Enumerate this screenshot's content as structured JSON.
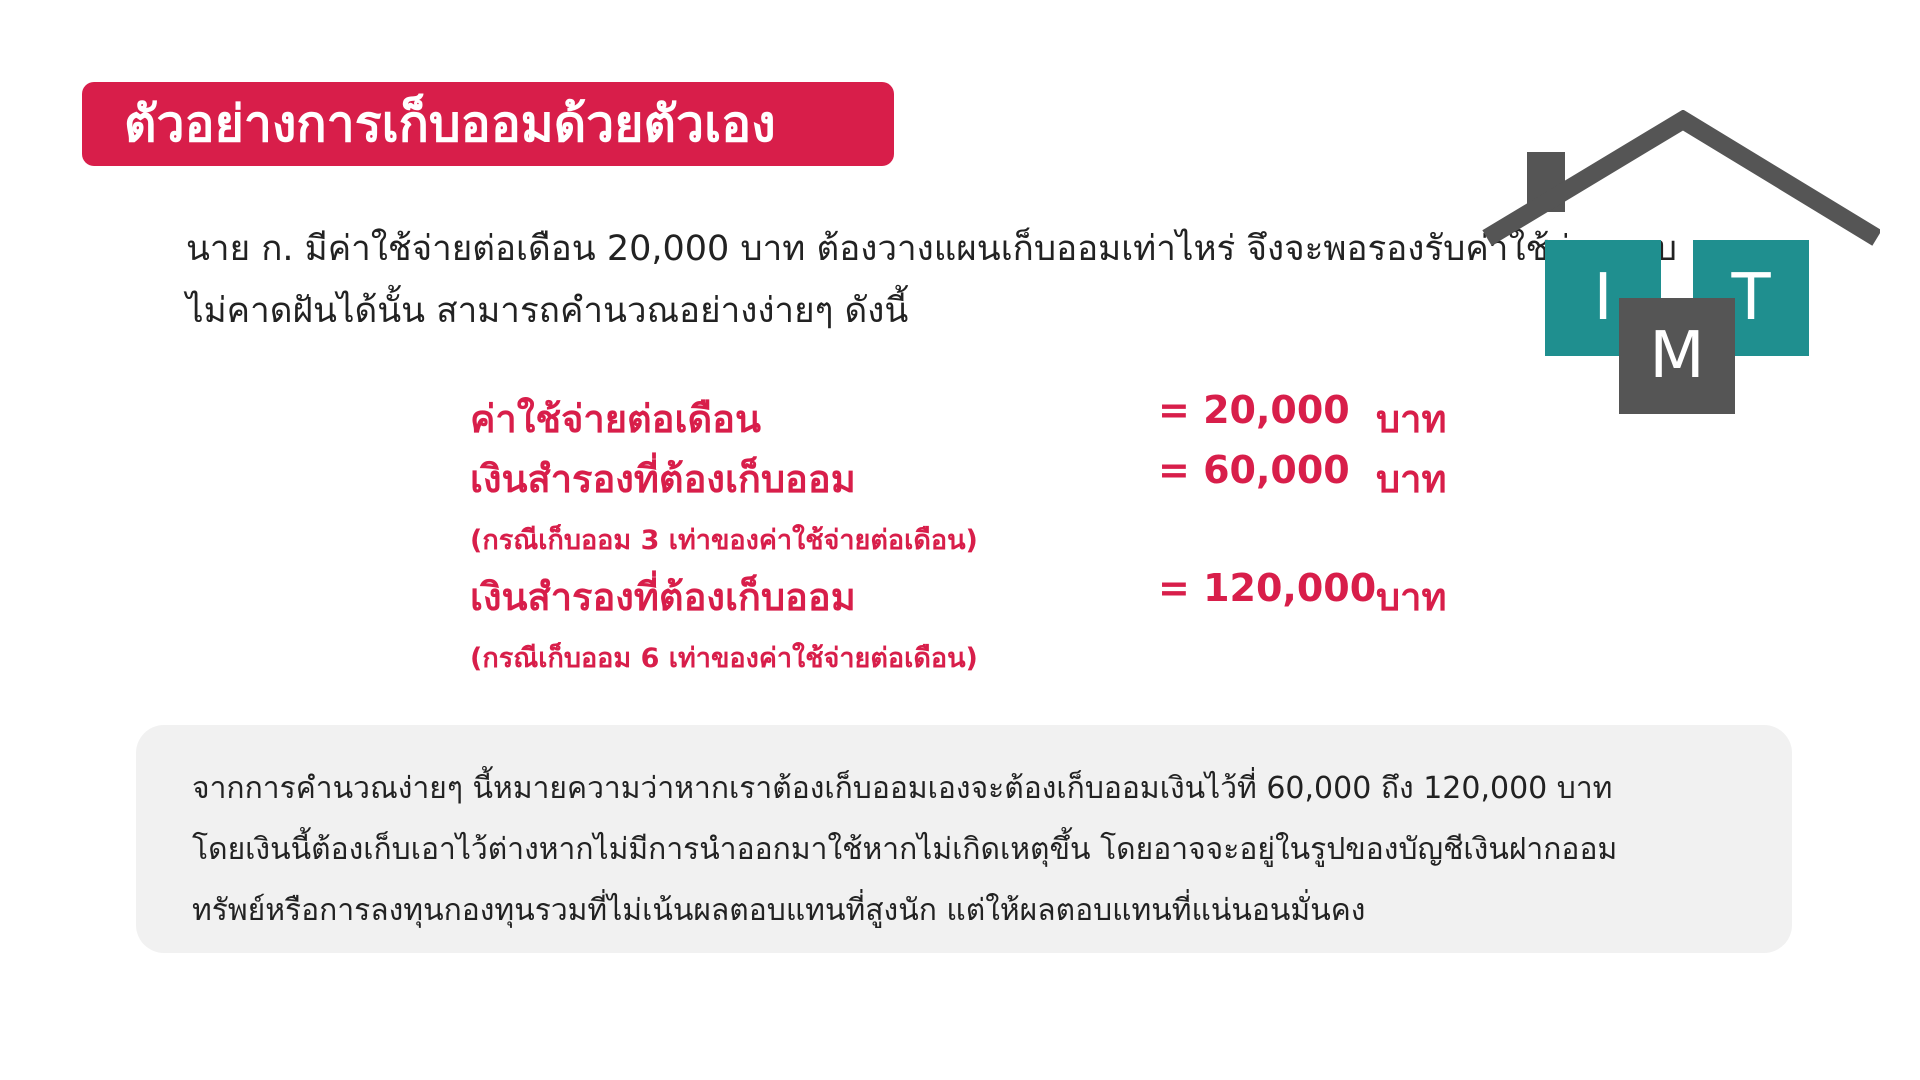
{
  "title": "ตัวอย่างการเก็บออมด้วยตัวเอง",
  "intro": {
    "line1": "นาย ก. มีค่าใช้จ่ายต่อเดือน 20,000 บาท ต้องวางแผนเก็บออมเท่าไหร่ จึงจะพอรองรับค่าใช้จ่ายแบบ",
    "line2": "ไม่คาดฝันได้นั้น สามารถคำนวณอย่างง่ายๆ ดังนี้"
  },
  "calculation": {
    "rows": [
      {
        "label": "ค่าใช้จ่ายต่อเดือน",
        "value": "= 20,000",
        "unit": "บาท"
      },
      {
        "label": "เงินสำรองที่ต้องเก็บออม",
        "value": "= 60,000",
        "unit": "บาท",
        "note": "(กรณีเก็บออม 3 เท่าของค่าใช้จ่ายต่อเดือน)"
      },
      {
        "label": "เงินสำรองที่ต้องเก็บออม",
        "value": "= 120,000",
        "unit": "บาท",
        "note": "(กรณีเก็บออม 6 เท่าของค่าใช้จ่ายต่อเดือน)"
      }
    ]
  },
  "summary": {
    "line1": "จากการคำนวณง่ายๆ นี้หมายความว่าหากเราต้องเก็บออมเองจะต้องเก็บออมเงินไว้ที่ 60,000 ถึง 120,000 บาท",
    "line2": "โดยเงินนี้ต้องเก็บเอาไว้ต่างหากไม่มีการนำออกมาใช้หากไม่เกิดเหตุขึ้น โดยอาจจะอยู่ในรูปของบัญชีเงินฝากออม",
    "line3": "ทรัพย์หรือการลงทุนกองทุนรวมที่ไม่เน้นผลตอบแทนที่สูงนัก แต่ให้ผลตอบแทนที่แน่นอนมั่นคง"
  },
  "logo": {
    "letters": [
      "I",
      "M",
      "T"
    ],
    "colors": {
      "teal": "#1f8f8f",
      "gray": "#555555",
      "roof": "#555555"
    }
  },
  "colors": {
    "accent": "#d81e4a",
    "summary_bg": "#f1f1f1"
  }
}
